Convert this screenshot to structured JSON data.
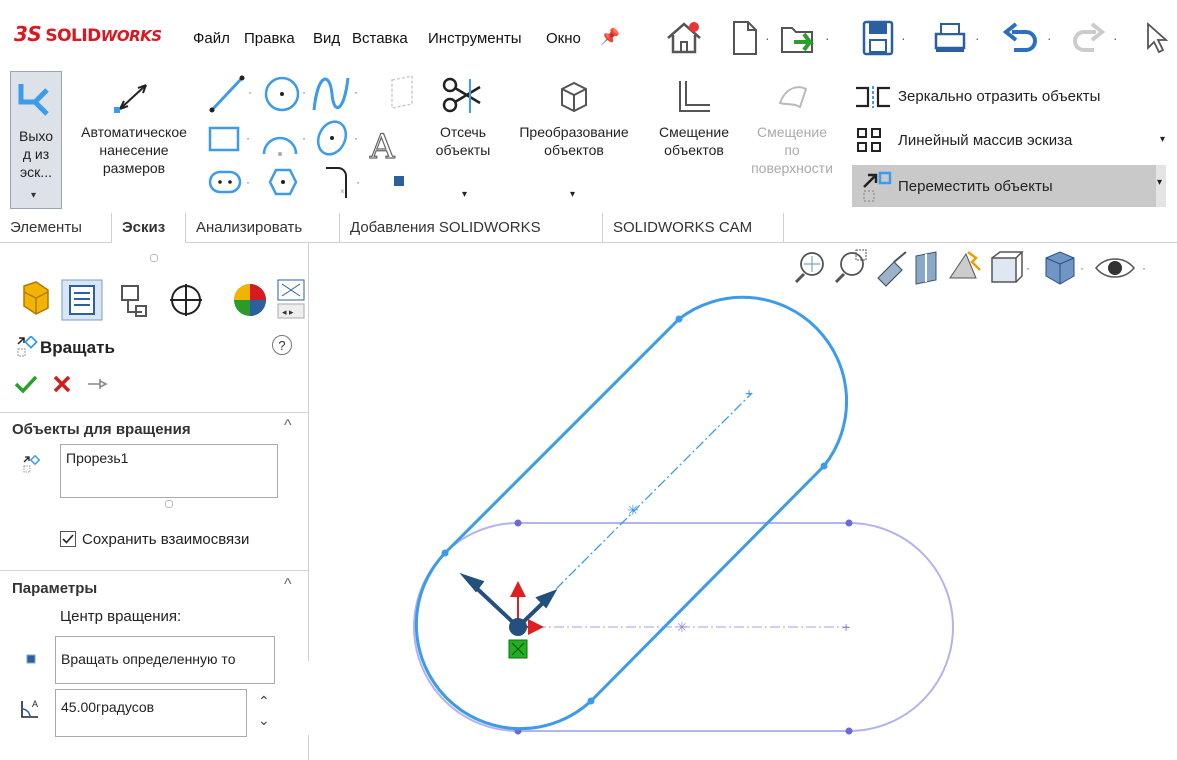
{
  "titlebar": {
    "logo_mark": "3S",
    "logo_solid": "SOLID",
    "logo_works": "WORKS",
    "menu": [
      "Файл",
      "Правка",
      "Вид",
      "Вставка",
      "Инструменты",
      "Окно"
    ]
  },
  "ribbon": {
    "exit_sketch_label": [
      "Выхо",
      "д из",
      "эск..."
    ],
    "smart_dimension_label": [
      "Автоматическое",
      "нанесение",
      "размеров"
    ],
    "trim_label": [
      "Отсечь",
      "объекты"
    ],
    "convert_label": [
      "Преобразование",
      "объектов"
    ],
    "offset_label": [
      "Смещение",
      "объектов"
    ],
    "offset_surface_label": [
      "Смещение",
      "по",
      "поверхности"
    ],
    "mirror_label": "Зеркально отразить объекты",
    "linear_pattern_label": "Линейный массив эскиза",
    "move_label": "Переместить объекты"
  },
  "tabs": [
    "Элементы",
    "Эскиз",
    "Анализировать",
    "Добавления SOLIDWORKS",
    "SOLIDWORKS CAM"
  ],
  "panel": {
    "title": "Вращать",
    "help": "?",
    "section_objects": "Объекты для вращения",
    "objects_list": [
      "Прорезь1"
    ],
    "keep_relations": "Сохранить взаимосвязи",
    "section_params": "Параметры",
    "center_label": "Центр вращения:",
    "center_value": "Вращать определенную то",
    "angle_value": "45.00градусов"
  },
  "colors": {
    "accent": "#3d9be9",
    "ghost": "#b3b3f0",
    "confirm": "#2aa02a",
    "cancel": "#d71920"
  }
}
